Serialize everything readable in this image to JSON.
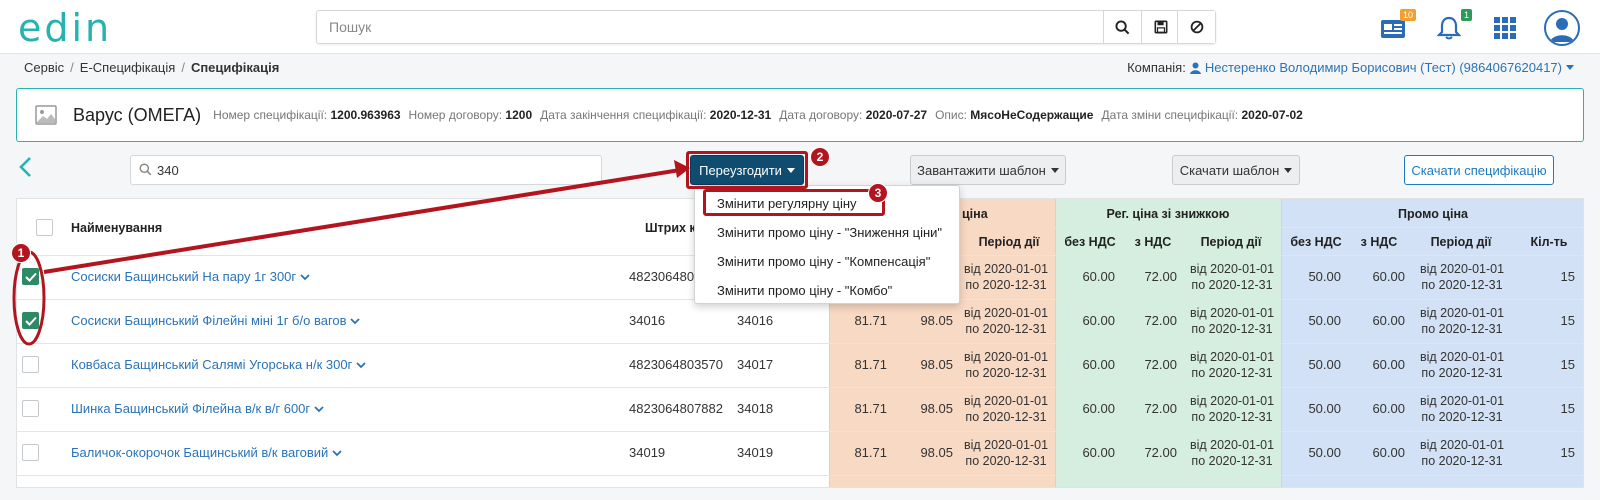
{
  "app": {
    "logo": "edin"
  },
  "search": {
    "placeholder": "Пошук",
    "value": ""
  },
  "top_icons": {
    "documents_badge": "10",
    "notifications_badge": "1"
  },
  "breadcrumb": {
    "items": [
      "Сервіс",
      "Е-Специфікація",
      "Специфікація"
    ]
  },
  "company": {
    "label": "Компанія:",
    "value": "Нестеренко Володимир Борисович (Тест) (9864067620417)"
  },
  "spec": {
    "title": "Варус (ОМЕГА)",
    "fields": [
      {
        "label": "Номер специфікації:",
        "value": "1200.963963"
      },
      {
        "label": "Номер договору:",
        "value": "1200"
      },
      {
        "label": "Дата закінчення специфікації:",
        "value": "2020-12-31"
      },
      {
        "label": "Дата договору:",
        "value": "2020-07-27"
      },
      {
        "label": "Опис:",
        "value": "МясоНеСодержащие"
      },
      {
        "label": "Дата зміни специфікації:",
        "value": "2020-07-02"
      }
    ]
  },
  "toolbar": {
    "filter_value": "340",
    "reconcile_button": "Переузгодити",
    "upload_template_button": "Завантажити шаблон",
    "download_template_button": "Скачати шаблон",
    "download_spec_button": "Скачати специфікацію"
  },
  "dropdown": {
    "items": [
      "Змінити регулярну ціну",
      "Змінити промо ціну - \"Зниження ціни\"",
      "Змінити промо ціну - \"Компенсація\"",
      "Змінити промо ціну - \"Комбо\""
    ]
  },
  "table": {
    "headers": {
      "name": "Найменування",
      "barcode": "Штрих к",
      "reg_price_tail": "ціна",
      "reg_discount_group": "Рег. ціна зі знижкою",
      "promo_group": "Промо ціна",
      "period": "Період дії",
      "without_vat": "без НДС",
      "with_vat": "з НДС",
      "qty": "Кіл-ть"
    },
    "rows": [
      {
        "checked": true,
        "name": "Сосиски Бащинський На пару 1г 300г",
        "barcode": "4823064806",
        "code": "",
        "reg_net": "",
        "reg_gross": "",
        "reg_period": [
          "від 2020-01-01",
          "по 2020-12-31"
        ],
        "disc_net": "60.00",
        "disc_gross": "72.00",
        "disc_period": [
          "від 2020-01-01",
          "по 2020-12-31"
        ],
        "promo_net": "50.00",
        "promo_gross": "60.00",
        "promo_period": [
          "від 2020-01-01",
          "по 2020-12-31"
        ],
        "qty": "15"
      },
      {
        "checked": true,
        "name": "Сосиски Бащинський Філейні міні 1г б/о вагов",
        "barcode": "34016",
        "code": "34016",
        "reg_net": "81.71",
        "reg_gross": "98.05",
        "reg_period": [
          "від 2020-01-01",
          "по 2020-12-31"
        ],
        "disc_net": "60.00",
        "disc_gross": "72.00",
        "disc_period": [
          "від 2020-01-01",
          "по 2020-12-31"
        ],
        "promo_net": "50.00",
        "promo_gross": "60.00",
        "promo_period": [
          "від 2020-01-01",
          "по 2020-12-31"
        ],
        "qty": "15"
      },
      {
        "checked": false,
        "name": "Ковбаса Бащинський Салямі Угорська н/к 300г",
        "barcode": "4823064803570",
        "code": "34017",
        "reg_net": "81.71",
        "reg_gross": "98.05",
        "reg_period": [
          "від 2020-01-01",
          "по 2020-12-31"
        ],
        "disc_net": "60.00",
        "disc_gross": "72.00",
        "disc_period": [
          "від 2020-01-01",
          "по 2020-12-31"
        ],
        "promo_net": "50.00",
        "promo_gross": "60.00",
        "promo_period": [
          "від 2020-01-01",
          "по 2020-12-31"
        ],
        "qty": "15"
      },
      {
        "checked": false,
        "name": "Шинка Бащинський Філейна в/к в/г 600г",
        "barcode": "4823064807882",
        "code": "34018",
        "reg_net": "81.71",
        "reg_gross": "98.05",
        "reg_period": [
          "від 2020-01-01",
          "по 2020-12-31"
        ],
        "disc_net": "60.00",
        "disc_gross": "72.00",
        "disc_period": [
          "від 2020-01-01",
          "по 2020-12-31"
        ],
        "promo_net": "50.00",
        "promo_gross": "60.00",
        "promo_period": [
          "від 2020-01-01",
          "по 2020-12-31"
        ],
        "qty": "15"
      },
      {
        "checked": false,
        "name": "Баличок-окорочок Бащинський в/к ваговий",
        "barcode": "34019",
        "code": "34019",
        "reg_net": "81.71",
        "reg_gross": "98.05",
        "reg_period": [
          "від 2020-01-01",
          "по 2020-12-31"
        ],
        "disc_net": "60.00",
        "disc_gross": "72.00",
        "disc_period": [
          "від 2020-01-01",
          "по 2020-12-31"
        ],
        "promo_net": "50.00",
        "promo_gross": "60.00",
        "promo_period": [
          "від 2020-01-01",
          "по 2020-12-31"
        ],
        "qty": "15"
      }
    ]
  },
  "annotations": [
    "1",
    "2",
    "3"
  ],
  "colors": {
    "brand": "#26b3b0",
    "primary_button": "#0f4c70",
    "link": "#2a73b8",
    "checkbox_checked": "#2d8a67",
    "annotation": "#b3151f",
    "reg_price_bg": "#f8d9c3",
    "discount_price_bg": "#d6eedf",
    "promo_price_bg": "#d2e1f5"
  }
}
